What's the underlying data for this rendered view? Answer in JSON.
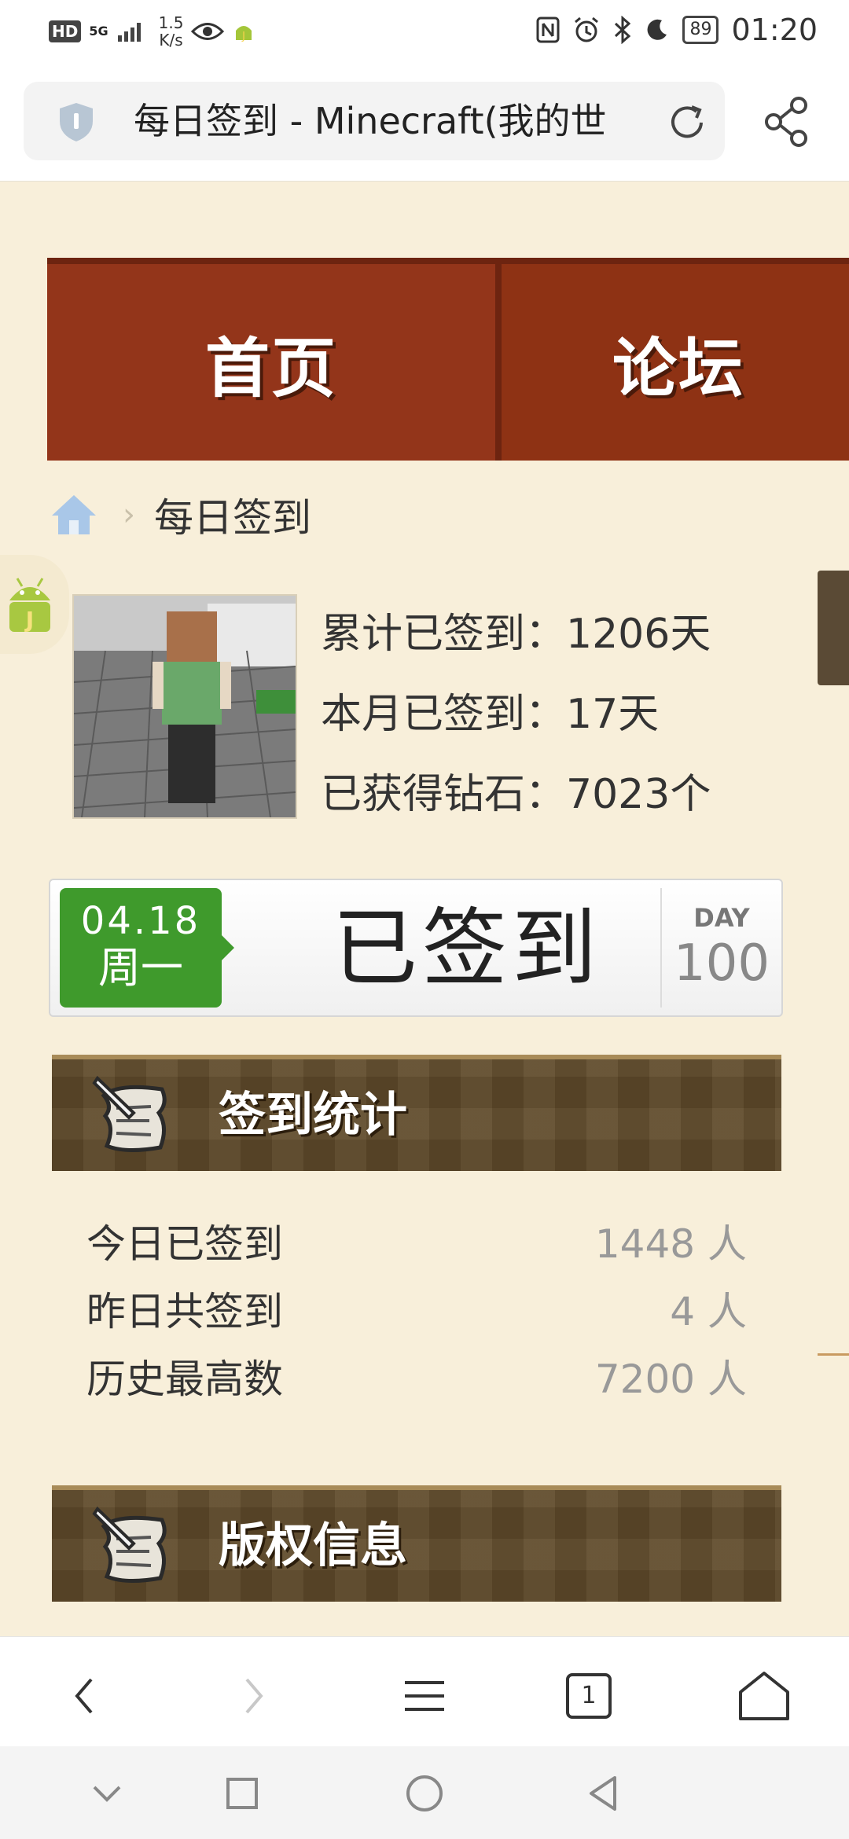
{
  "status_bar": {
    "hd": "HD",
    "network": "5G",
    "speed_value": "1.5",
    "speed_unit": "K/s",
    "battery": "89",
    "time": "01:20",
    "icons": [
      "eye-icon",
      "android-j-icon",
      "nfc-icon",
      "alarm-icon",
      "bluetooth-icon",
      "moon-icon"
    ]
  },
  "browser": {
    "tab_title": "每日签到 - Minecraft(我的世",
    "icons": [
      "shield-icon",
      "reload-icon",
      "share-icon"
    ]
  },
  "nav": {
    "home": "首页",
    "forum": "论坛"
  },
  "breadcrumb": {
    "sep": "›",
    "current": "每日签到"
  },
  "user": {
    "total_signed": "累计已签到：1206天",
    "month_signed": "本月已签到：17天",
    "diamonds": "已获得钻石：7023个"
  },
  "signin": {
    "date": "04.18",
    "weekday": "周一",
    "status": "已签到",
    "day_label": "DAY",
    "day_count": "100"
  },
  "sections": {
    "stats_title": "签到统计",
    "copyright_title": "版权信息"
  },
  "stats": [
    {
      "label": "今日已签到",
      "value": "1448 人"
    },
    {
      "label": "昨日共签到",
      "value": "4 人"
    },
    {
      "label": "历史最高数",
      "value": "7200 人"
    }
  ],
  "toolbar": {
    "tab_count": "1",
    "icons": [
      "back-icon",
      "forward-icon",
      "menu-icon",
      "tabs-icon",
      "home-icon"
    ]
  },
  "colors": {
    "page_bg": "#f8efda",
    "nav_red": "#8e3214",
    "sign_green": "#3f9a2c",
    "section_brown": "#5f4a2a"
  }
}
